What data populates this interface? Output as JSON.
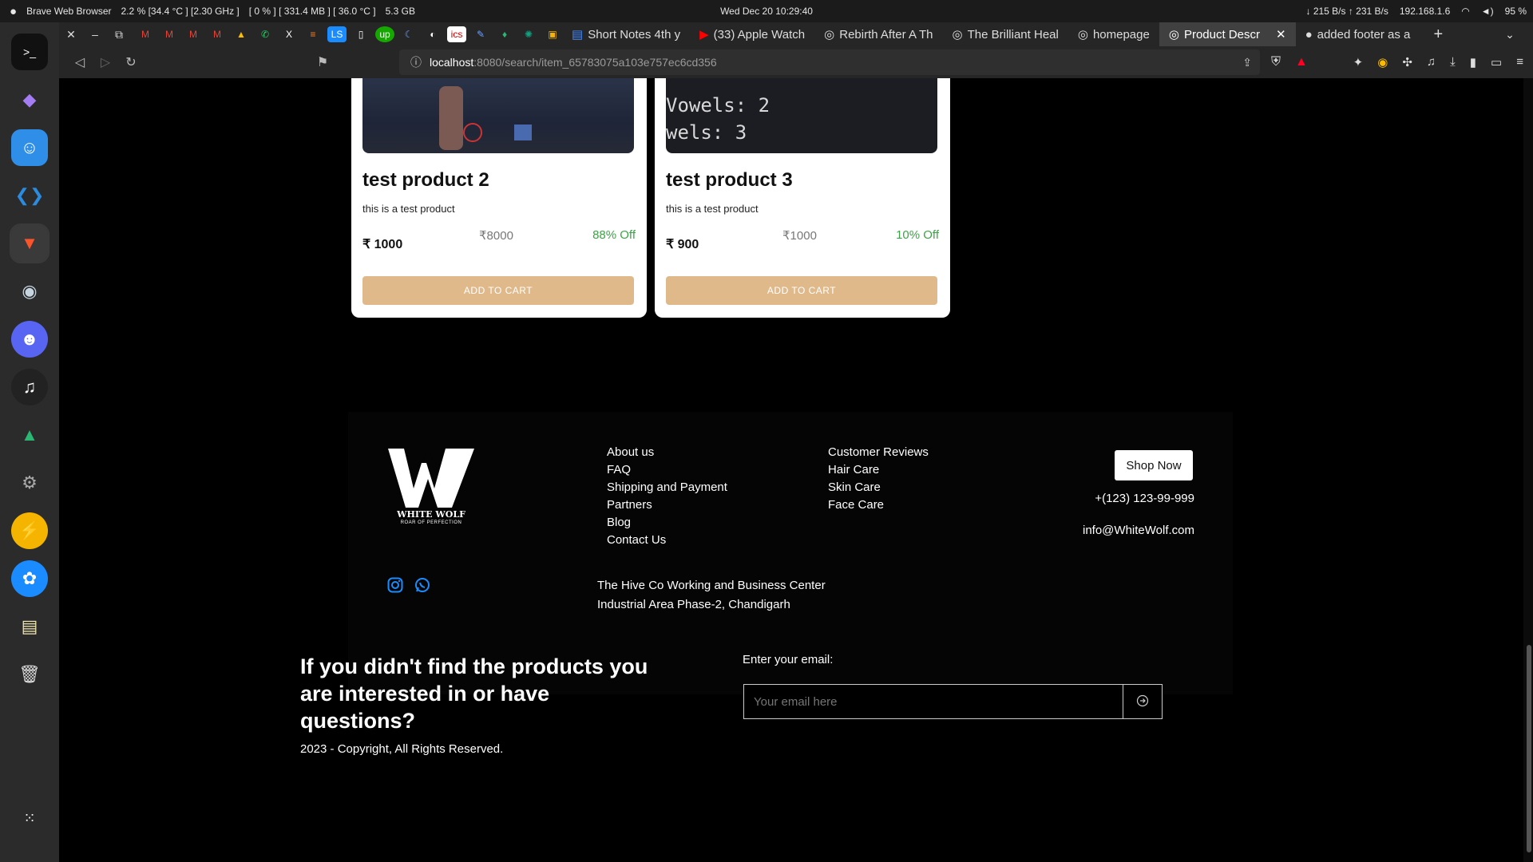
{
  "system_bar": {
    "app_name": "Brave Web Browser",
    "cpu": "2.2 % [34.4 °C ] [2.30 GHz ]",
    "gpu": "[ 0 % ] [ 331.4 MB ] [ 36.0 °C ]",
    "memory": "5.3 GB",
    "clock": "Wed Dec 20  10:29:40",
    "network_speed": "↓ 215 B/s  ↑ 231 B/s",
    "ip": "192.168.1.6",
    "battery": "95 %"
  },
  "tabs": [
    {
      "label": "Short Notes 4th y"
    },
    {
      "label": "(33) Apple Watch"
    },
    {
      "label": "Rebirth After A Th"
    },
    {
      "label": "The Brilliant Heal"
    },
    {
      "label": "homepage"
    },
    {
      "label": "Product Descr"
    },
    {
      "label": "added footer as a"
    }
  ],
  "address_bar": {
    "host": "localhost",
    "path": ":8080/search/item_65783075a103e757ec6cd356"
  },
  "products": [
    {
      "title": "test product 2",
      "desc": "this is a test product",
      "price": "₹ 1000",
      "mrp": "₹8000",
      "off": "88% Off",
      "cart": "ADD TO CART",
      "snippet": ""
    },
    {
      "title": "test product 3",
      "desc": "this is a test product",
      "price": "₹ 900",
      "mrp": "₹1000",
      "off": "10% Off",
      "cart": "ADD TO CART",
      "snippet_1": "Vowels: 2",
      "snippet_2": "wels: 3"
    }
  ],
  "footer": {
    "logo_brand": "WHITE WOLF",
    "logo_tag": "ROAR OF PERFECTION",
    "links_col1": [
      "About us",
      "FAQ",
      "Shipping and Payment",
      "Partners",
      "Blog",
      "Contact Us"
    ],
    "links_col2": [
      "Customer Reviews",
      "Hair Care",
      "Skin Care",
      "Face Care"
    ],
    "shop_now": "Shop Now",
    "phone": "+(123) 123-99-999",
    "email": "info@WhiteWolf.com",
    "address_line1": "The Hive Co Working and Business Center",
    "address_line2": "Industrial Area Phase-2, Chandigarh"
  },
  "bottom": {
    "question": "If you didn't find the products you are interested in or have questions?",
    "copyright": "2023 - Copyright, All Rights Reserved.",
    "email_label": "Enter your email:",
    "email_placeholder": "Your email here"
  },
  "colors": {
    "cart_button": "#e0b98a",
    "discount": "#3aa544",
    "social_icons": "#1a8cff"
  }
}
